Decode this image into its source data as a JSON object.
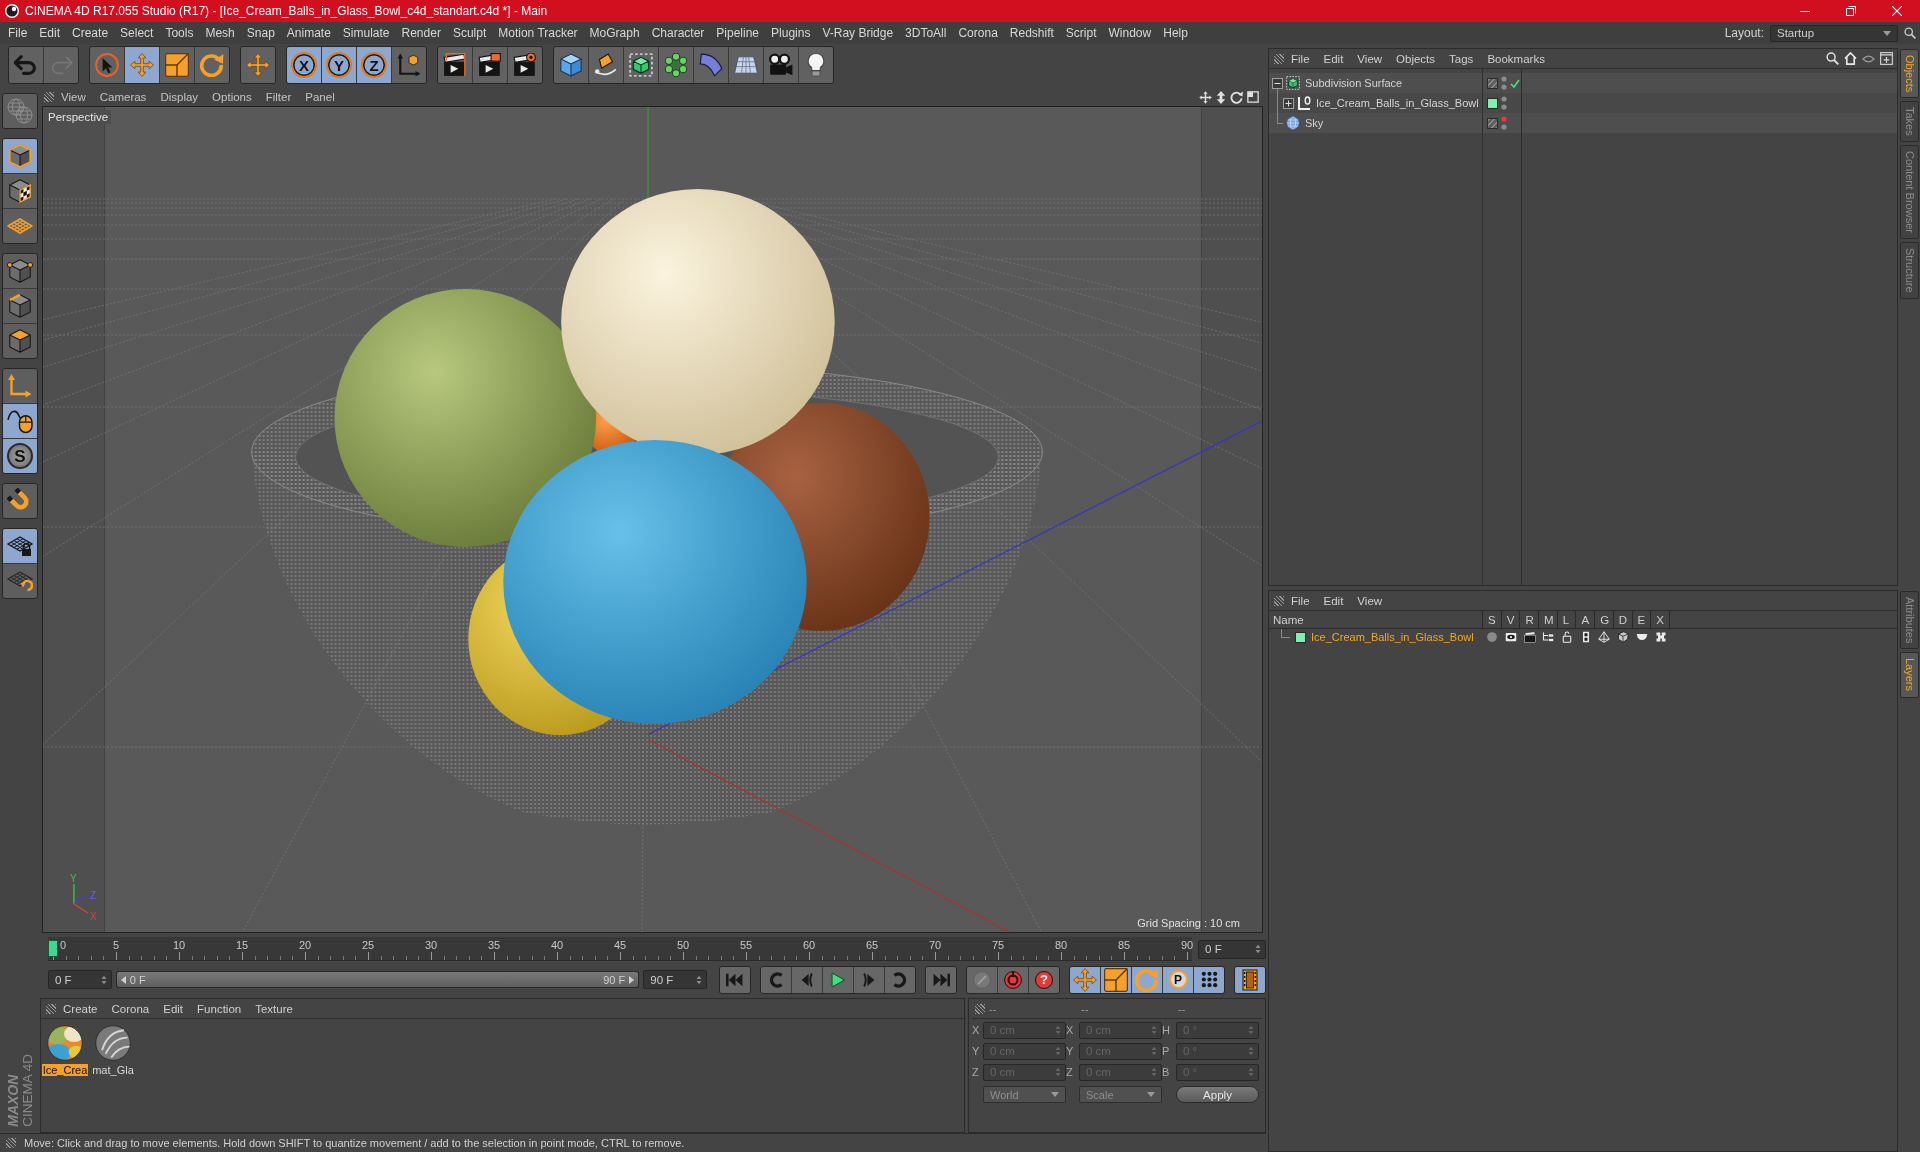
{
  "window": {
    "title": "CINEMA 4D R17.055 Studio (R17) - [Ice_Cream_Balls_in_Glass_Bowl_c4d_standart.c4d *] - Main"
  },
  "menu": [
    "File",
    "Edit",
    "Create",
    "Select",
    "Tools",
    "Mesh",
    "Snap",
    "Animate",
    "Simulate",
    "Render",
    "Sculpt",
    "Motion Tracker",
    "MoGraph",
    "Character",
    "Pipeline",
    "Plugins",
    "V-Ray Bridge",
    "3DToAll",
    "Corona",
    "Redshift",
    "Script",
    "Window",
    "Help"
  ],
  "layout": {
    "label": "Layout:",
    "value": "Startup"
  },
  "toolbar": [
    [
      {
        "kind": "undo",
        "active": false,
        "disabled": false
      },
      {
        "kind": "redo",
        "active": false,
        "disabled": true
      }
    ],
    [
      {
        "kind": "select",
        "active": false,
        "disabled": false
      },
      {
        "kind": "move",
        "active": true,
        "disabled": false
      },
      {
        "kind": "scale",
        "active": false,
        "disabled": false
      },
      {
        "kind": "rotate",
        "active": false,
        "disabled": false
      }
    ],
    [
      {
        "kind": "transform",
        "active": false,
        "disabled": false
      }
    ],
    [
      {
        "kind": "axis",
        "label": "X",
        "active": true,
        "disabled": false
      },
      {
        "kind": "axis",
        "label": "Y",
        "active": true,
        "disabled": false
      },
      {
        "kind": "axis",
        "label": "Z",
        "active": true,
        "disabled": false
      },
      {
        "kind": "coordinates",
        "active": false,
        "disabled": false
      }
    ],
    [
      {
        "kind": "render-view",
        "active": false,
        "disabled": false
      },
      {
        "kind": "render-picture",
        "active": false,
        "disabled": false
      },
      {
        "kind": "render-settings",
        "active": false,
        "disabled": false
      }
    ],
    [
      {
        "kind": "cube",
        "active": false,
        "disabled": false
      },
      {
        "kind": "pen",
        "active": false,
        "disabled": false
      },
      {
        "kind": "subdivision",
        "active": false,
        "disabled": false
      },
      {
        "kind": "cloner",
        "active": false,
        "disabled": false
      },
      {
        "kind": "deformer",
        "active": false,
        "disabled": false
      },
      {
        "kind": "floor",
        "active": false,
        "disabled": false
      },
      {
        "kind": "camera",
        "active": false,
        "disabled": false
      },
      {
        "kind": "light",
        "active": false,
        "disabled": false
      }
    ]
  ],
  "tool_palette": [
    [
      {
        "kind": "make-editable",
        "active": false,
        "disabled": true
      }
    ],
    [
      {
        "kind": "model",
        "active": true,
        "disabled": false
      },
      {
        "kind": "texture",
        "active": false,
        "disabled": false
      },
      {
        "kind": "workplane",
        "active": false,
        "disabled": false
      }
    ],
    [
      {
        "kind": "points",
        "active": false,
        "disabled": false
      },
      {
        "kind": "edges",
        "active": false,
        "disabled": false
      },
      {
        "kind": "polygons",
        "active": false,
        "disabled": false
      }
    ],
    [
      {
        "kind": "axis-mode",
        "active": false,
        "disabled": false
      },
      {
        "kind": "tweak",
        "active": true,
        "disabled": false
      },
      {
        "kind": "snap",
        "label": "S",
        "active": true,
        "disabled": false
      }
    ],
    [
      {
        "kind": "magnet",
        "active": false,
        "disabled": false
      }
    ],
    [
      {
        "kind": "lock-workplane",
        "active": true,
        "disabled": false
      },
      {
        "kind": "planar-workplane",
        "active": false,
        "disabled": false
      }
    ]
  ],
  "viewport": {
    "menu": [
      "View",
      "Cameras",
      "Display",
      "Options",
      "Filter",
      "Panel"
    ],
    "camera": "Perspective",
    "grid_spacing": "Grid Spacing : 10 cm",
    "axis_labels": [
      "Y",
      "Z",
      "X"
    ]
  },
  "timeline": {
    "ticks": [
      "0",
      "5",
      "10",
      "15",
      "20",
      "25",
      "30",
      "35",
      "40",
      "45",
      "50",
      "55",
      "60",
      "65",
      "70",
      "75",
      "80",
      "85",
      "90"
    ],
    "playhead": {
      "level": 0
    },
    "frame_field": "0 F"
  },
  "playback": {
    "start_field": "0 F",
    "range": {
      "start": "0 F",
      "end": "90 F",
      "level": 1
    },
    "end_field": "90 F",
    "groups": [
      [
        {
          "kind": "go-start",
          "active": false,
          "disabled": false
        }
      ],
      [
        {
          "kind": "prev-key",
          "active": false,
          "disabled": false
        },
        {
          "kind": "prev-frame",
          "active": false,
          "disabled": false
        },
        {
          "kind": "play",
          "active": false,
          "disabled": false
        },
        {
          "kind": "next-frame",
          "active": false,
          "disabled": false
        },
        {
          "kind": "next-key",
          "active": false,
          "disabled": false
        }
      ],
      [
        {
          "kind": "go-end",
          "active": false,
          "disabled": false
        }
      ],
      [
        {
          "kind": "record",
          "active": false,
          "disabled": true
        },
        {
          "kind": "autokey",
          "active": false,
          "disabled": false
        },
        {
          "kind": "keyframe-selection",
          "label": "?",
          "active": false,
          "disabled": false
        }
      ],
      [
        {
          "kind": "move",
          "active": true,
          "disabled": false
        },
        {
          "kind": "scale",
          "active": true,
          "disabled": false
        },
        {
          "kind": "rotate",
          "active": true,
          "disabled": false
        },
        {
          "kind": "parameter",
          "label": "P",
          "active": true,
          "disabled": false
        },
        {
          "kind": "points-mode",
          "active": true,
          "disabled": false
        }
      ],
      [
        {
          "kind": "timeline",
          "active": true,
          "disabled": false
        }
      ]
    ]
  },
  "materials": {
    "menu": [
      "Create",
      "Corona",
      "Edit",
      "Function",
      "Texture"
    ],
    "items": [
      {
        "name": "Ice_Crea",
        "kind": "multicolor",
        "selected": true
      },
      {
        "name": "mat_Gla",
        "kind": "glass",
        "selected": false
      }
    ]
  },
  "coordinates": {
    "disabled": true,
    "headers": [
      "--",
      "--",
      "--"
    ],
    "rows": [
      [
        {
          "axis": "X",
          "value": "0 cm"
        },
        {
          "axis": "X",
          "value": "0 cm"
        },
        {
          "axis": "H",
          "value": "0 °"
        }
      ],
      [
        {
          "axis": "Y",
          "value": "0 cm"
        },
        {
          "axis": "Y",
          "value": "0 cm"
        },
        {
          "axis": "P",
          "value": "0 °"
        }
      ],
      [
        {
          "axis": "Z",
          "value": "0 cm"
        },
        {
          "axis": "Z",
          "value": "0 cm"
        },
        {
          "axis": "B",
          "value": "0 °"
        }
      ]
    ],
    "modes": [
      "World",
      "Scale"
    ],
    "apply": "Apply"
  },
  "status_bar": "Move: Click and drag to move elements. Hold down SHIFT to quantize movement / add to the selection in point mode, CTRL to remove.",
  "logo": {
    "brand": "MAXON",
    "product": "CINEMA 4D"
  },
  "objects": {
    "menu": [
      "File",
      "Edit",
      "View",
      "Objects",
      "Tags",
      "Bookmarks"
    ],
    "tree": [
      {
        "name": "Subdivision Surface",
        "kind": "subdivision",
        "expanded": true,
        "editor_hidden": false,
        "enabled": true,
        "children": [
          {
            "name": "Ice_Cream_Balls_in_Glass_Bowl",
            "kind": "null",
            "expanded": false,
            "color": "#80f0b0",
            "editor_hidden": false
          }
        ]
      },
      {
        "name": "Sky",
        "kind": "sky",
        "editor_hidden": true
      }
    ]
  },
  "layers": {
    "menu": [
      "File",
      "Edit",
      "View"
    ],
    "columns": [
      "Name",
      "S",
      "V",
      "R",
      "M",
      "L",
      "A",
      "G",
      "D",
      "E",
      "X"
    ],
    "rows": [
      {
        "name": "Ice_Cream_Balls_in_Glass_Bowl",
        "color": "#80f0b0",
        "selected": true,
        "flags": [
          {
            "on": false
          },
          {
            "on": true
          },
          {
            "on": true
          },
          {
            "on": true
          },
          {
            "on": false
          },
          {
            "on": true
          },
          {
            "on": true
          },
          {
            "on": true
          },
          {
            "on": true
          },
          {
            "on": true
          }
        ]
      }
    ]
  },
  "side_tabs": {
    "top": [
      {
        "label": "Objects",
        "selected": true
      },
      {
        "label": "Takes",
        "selected": false
      },
      {
        "label": "Content Browser",
        "selected": false
      },
      {
        "label": "Structure",
        "selected": false
      }
    ],
    "bottom": [
      {
        "label": "Attributes",
        "selected": false
      },
      {
        "label": "Layers",
        "selected": true
      }
    ]
  }
}
